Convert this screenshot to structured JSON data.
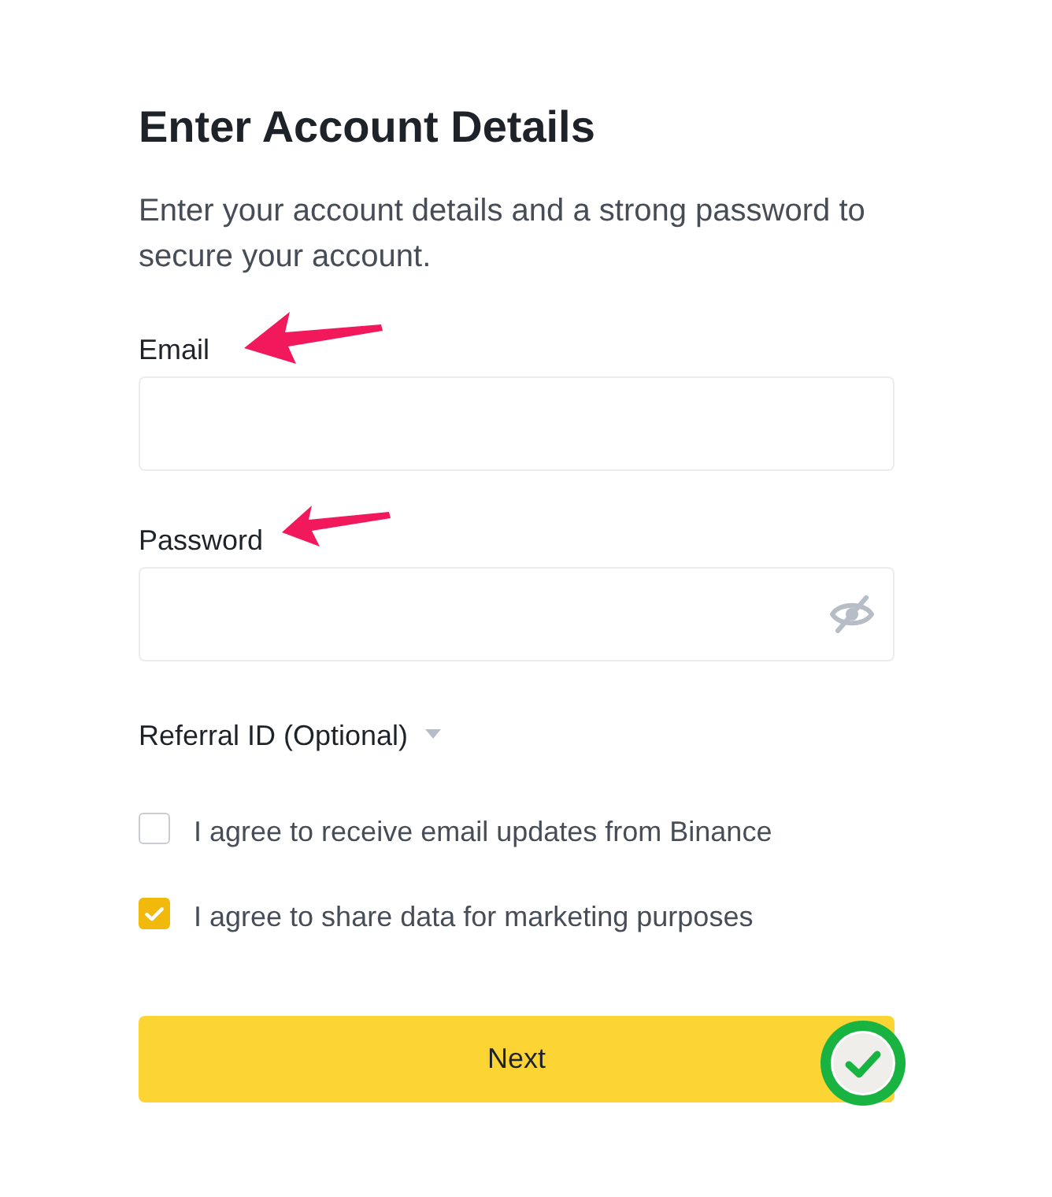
{
  "heading": "Enter Account Details",
  "description": "Enter your account details and a strong password to secure your account.",
  "fields": [
    {
      "kind": "text",
      "label": "Email"
    },
    {
      "kind": "password",
      "label": "Password"
    }
  ],
  "referral": {
    "label": "Referral ID (Optional)",
    "expanded": false
  },
  "agreements": [
    {
      "label": "I agree to receive email updates from Binance",
      "checked": false
    },
    {
      "label": "I agree to share data for marketing purposes",
      "checked": true
    }
  ],
  "submit": {
    "label": "Next"
  }
}
